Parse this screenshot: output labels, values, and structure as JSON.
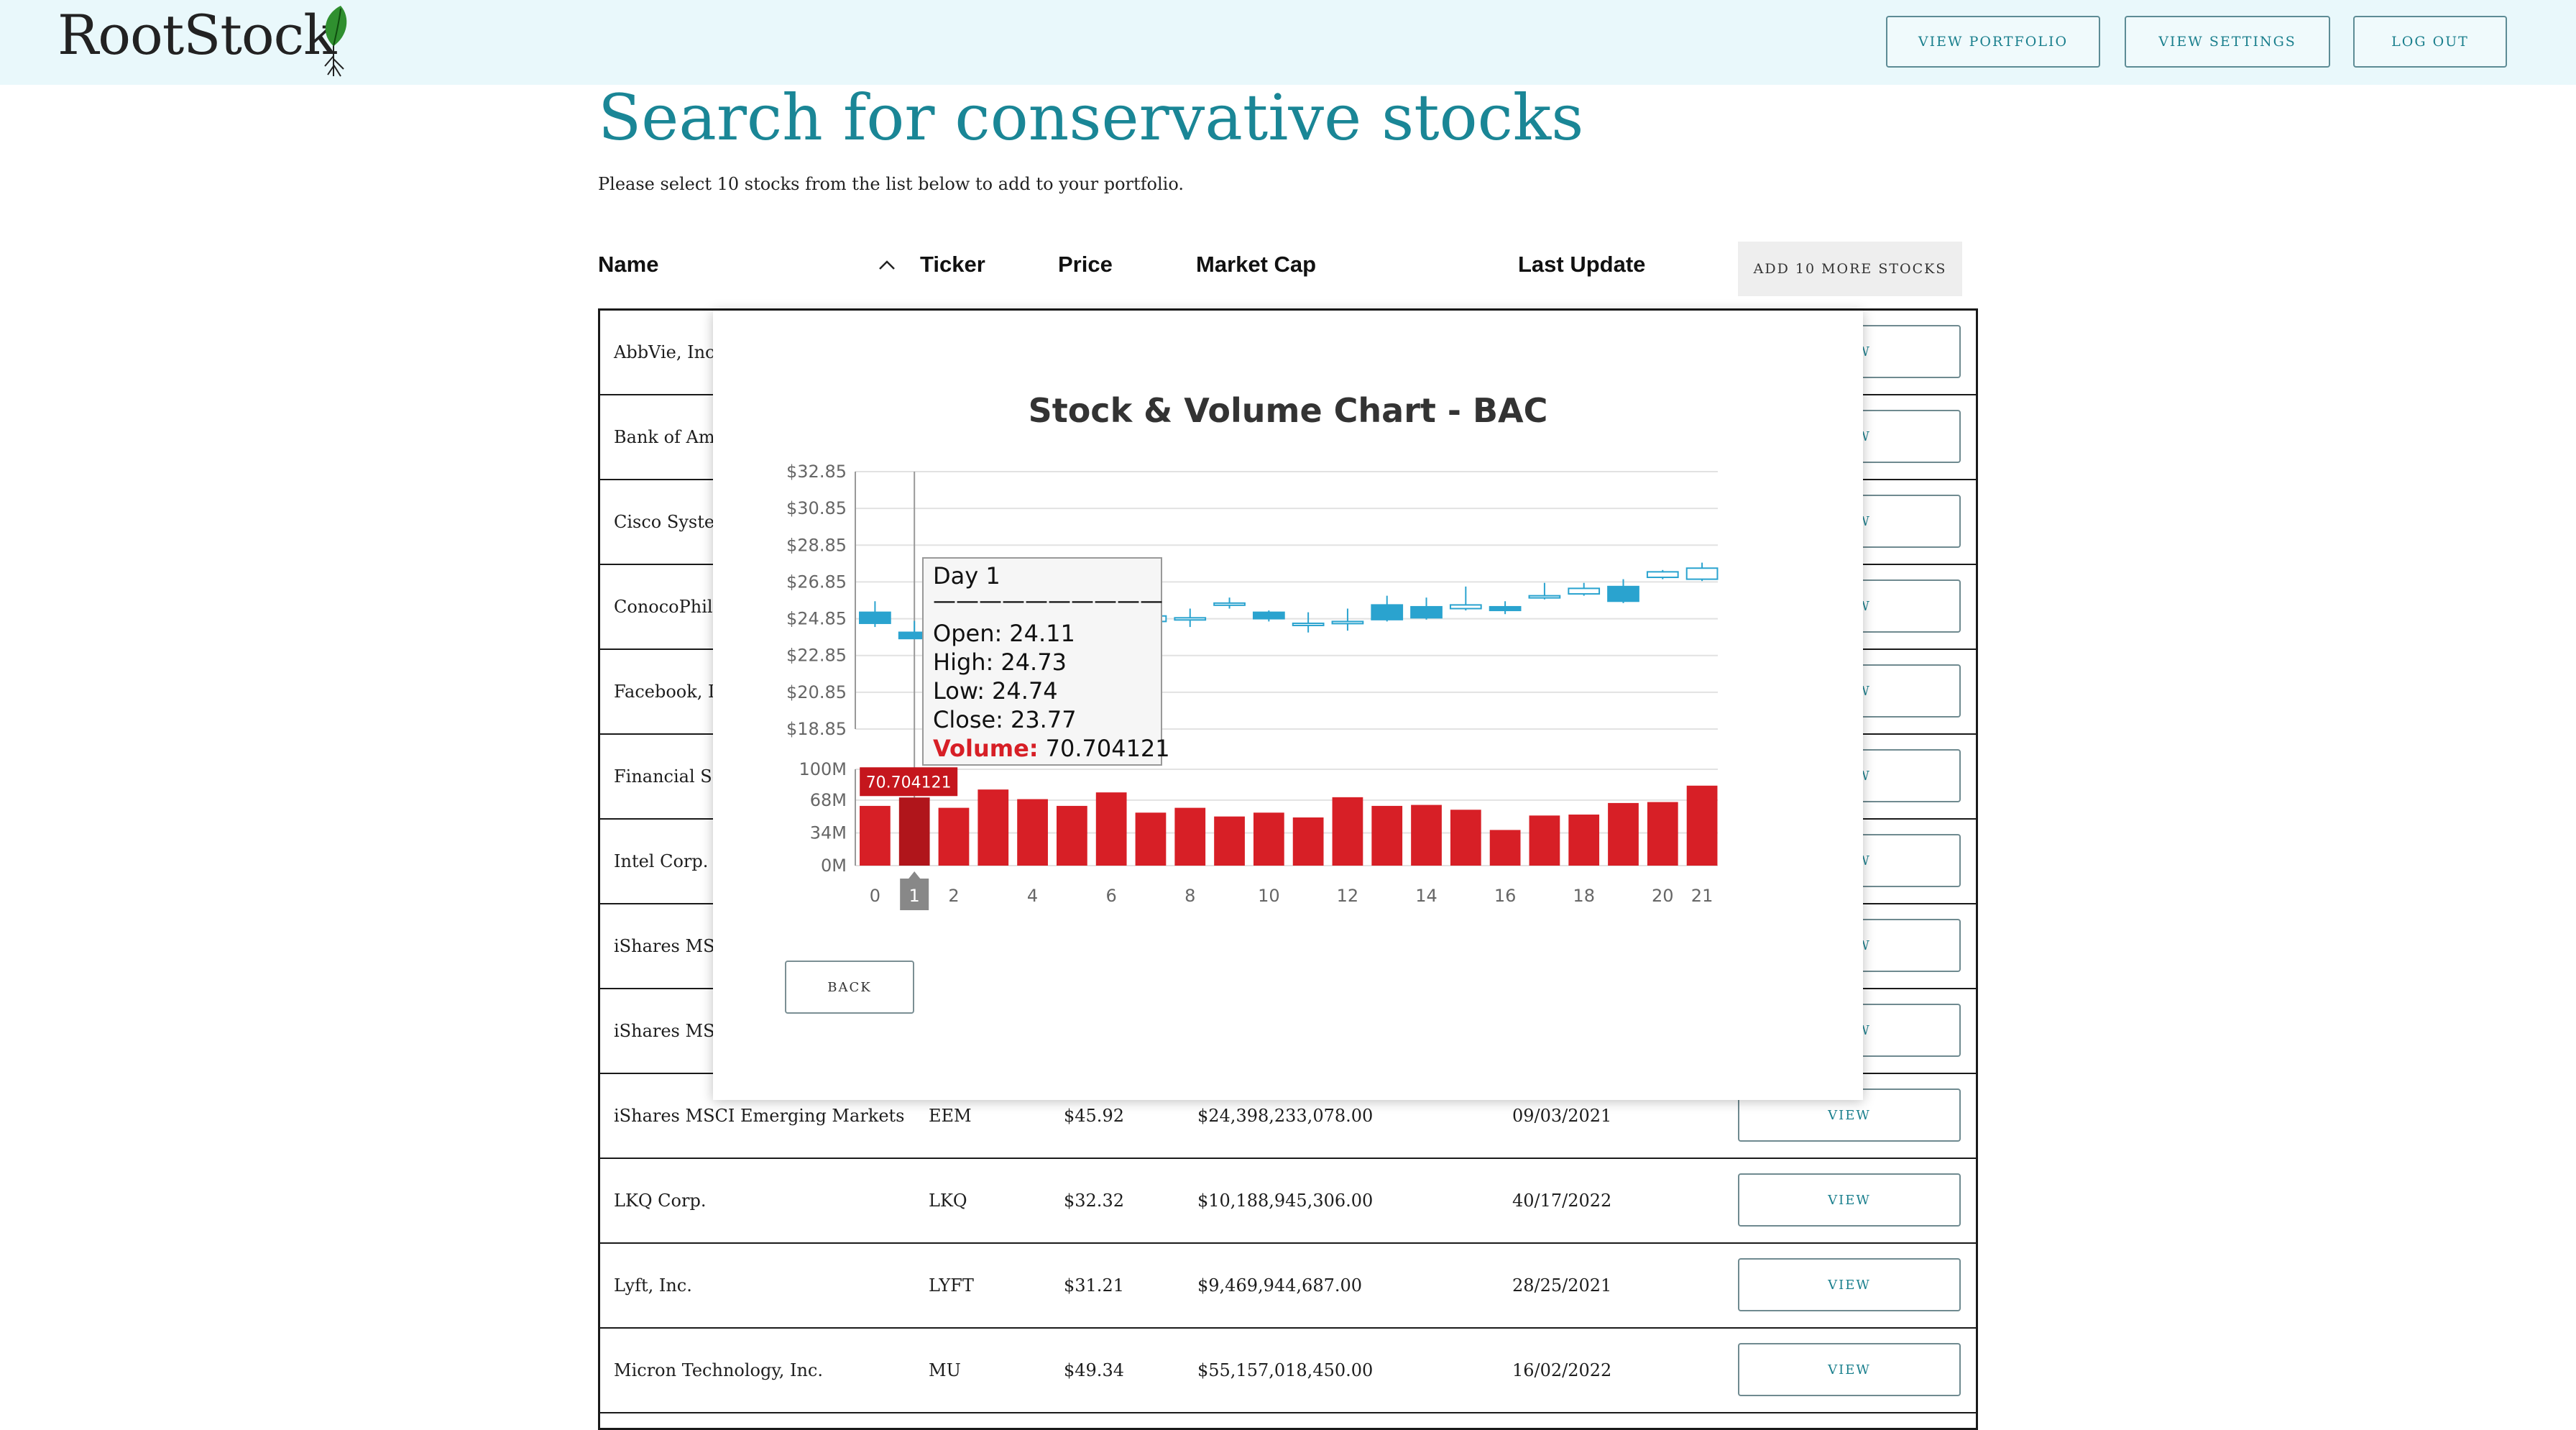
{
  "header": {
    "logo": "RootStock",
    "nav": [
      "VIEW PORTFOLIO",
      "VIEW SETTINGS",
      "LOG OUT"
    ]
  },
  "page": {
    "title": "Search for conservative stocks",
    "subtitle": "Please select 10 stocks from the list below to add to your portfolio.",
    "add_button": "ADD 10 MORE STOCKS"
  },
  "table": {
    "columns": [
      "Name",
      "Ticker",
      "Price",
      "Market Cap",
      "Last Update"
    ],
    "view_label": "VIEW",
    "rows": [
      {
        "name": "AbbVie, Inc."
      },
      {
        "name": "Bank of Am"
      },
      {
        "name": "Cisco Syster"
      },
      {
        "name": "ConocoPhill"
      },
      {
        "name": "Facebook, In"
      },
      {
        "name": "Financial Se"
      },
      {
        "name": "Intel Corp."
      },
      {
        "name": "iShares MSC"
      },
      {
        "name": "iShares MSC"
      },
      {
        "name": "iShares MSCI Emerging Markets",
        "ticker": "EEM",
        "price": "$45.92",
        "market_cap": "$24,398,233,078.00",
        "last_update": "09/03/2021"
      },
      {
        "name": "LKQ Corp.",
        "ticker": "LKQ",
        "price": "$32.32",
        "market_cap": "$10,188,945,306.00",
        "last_update": "40/17/2022"
      },
      {
        "name": "Lyft, Inc.",
        "ticker": "LYFT",
        "price": "$31.21",
        "market_cap": "$9,469,944,687.00",
        "last_update": "28/25/2021"
      },
      {
        "name": "Micron Technology, Inc.",
        "ticker": "MU",
        "price": "$49.34",
        "market_cap": "$55,157,018,450.00",
        "last_update": "16/02/2022"
      }
    ]
  },
  "modal": {
    "back_label": "BACK"
  },
  "colors": {
    "accent": "#1a8696",
    "header_bg": "#e9f8fb",
    "candle": "#2aa3cf",
    "volume": "#d71f26"
  },
  "chart_data": {
    "type": "candlestick",
    "title": "Stock & Volume Chart - BAC",
    "price_axis": {
      "ticks": [
        "$18.85",
        "$20.85",
        "$22.85",
        "$24.85",
        "$26.85",
        "$28.85",
        "$30.85",
        "$32.85"
      ],
      "range": [
        18.85,
        32.85
      ]
    },
    "volume_axis": {
      "ticks": [
        "0M",
        "34M",
        "68M",
        "100M"
      ],
      "range": [
        0,
        100
      ]
    },
    "x_ticks": [
      "0",
      "2",
      "4",
      "6",
      "8",
      "10",
      "12",
      "14",
      "16",
      "18",
      "20",
      "21"
    ],
    "highlight_tick": "1",
    "x": [
      0,
      1,
      2,
      3,
      4,
      5,
      6,
      7,
      8,
      9,
      10,
      11,
      12,
      13,
      14,
      15,
      16,
      17,
      18,
      19,
      20,
      21
    ],
    "open": [
      25.2,
      24.11,
      24.2,
      24.3,
      24.4,
      24.5,
      24.6,
      24.7,
      24.8,
      25.6,
      25.2,
      24.5,
      24.6,
      25.6,
      25.5,
      25.4,
      25.5,
      26.0,
      26.2,
      26.6,
      27.1,
      27.0
    ],
    "close": [
      24.6,
      23.77,
      24.5,
      24.6,
      24.7,
      24.8,
      24.9,
      25.0,
      24.9,
      25.7,
      24.85,
      24.6,
      24.7,
      24.8,
      24.9,
      25.6,
      25.3,
      26.1,
      26.5,
      25.8,
      27.4,
      27.6
    ],
    "high": [
      25.8,
      24.73,
      24.8,
      24.9,
      25.0,
      25.1,
      25.2,
      25.3,
      25.4,
      26.0,
      25.3,
      25.2,
      25.4,
      26.1,
      26.0,
      26.6,
      25.8,
      26.8,
      26.8,
      27.0,
      27.5,
      27.9
    ],
    "low": [
      24.4,
      24.74,
      24.0,
      24.1,
      24.2,
      24.3,
      24.4,
      24.5,
      24.4,
      25.4,
      24.7,
      24.1,
      24.2,
      24.7,
      24.8,
      25.3,
      25.1,
      25.9,
      26.1,
      25.7,
      27.0,
      26.9
    ],
    "volume": [
      62,
      70.704121,
      60,
      79,
      69,
      62,
      76,
      55,
      60,
      51,
      55,
      50,
      71,
      62,
      63,
      58,
      37,
      52,
      53,
      65,
      66,
      83
    ],
    "tooltip": {
      "day": "Day 1",
      "separator": "——————————",
      "open_label": "Open:",
      "open": "24.11",
      "high_label": "High:",
      "high": "24.73",
      "low_label": "Low:",
      "low": "24.74",
      "close_label": "Close:",
      "close": "23.77",
      "volume_label": "Volume:",
      "volume": "70.704121"
    },
    "volume_flag": "70.704121"
  }
}
